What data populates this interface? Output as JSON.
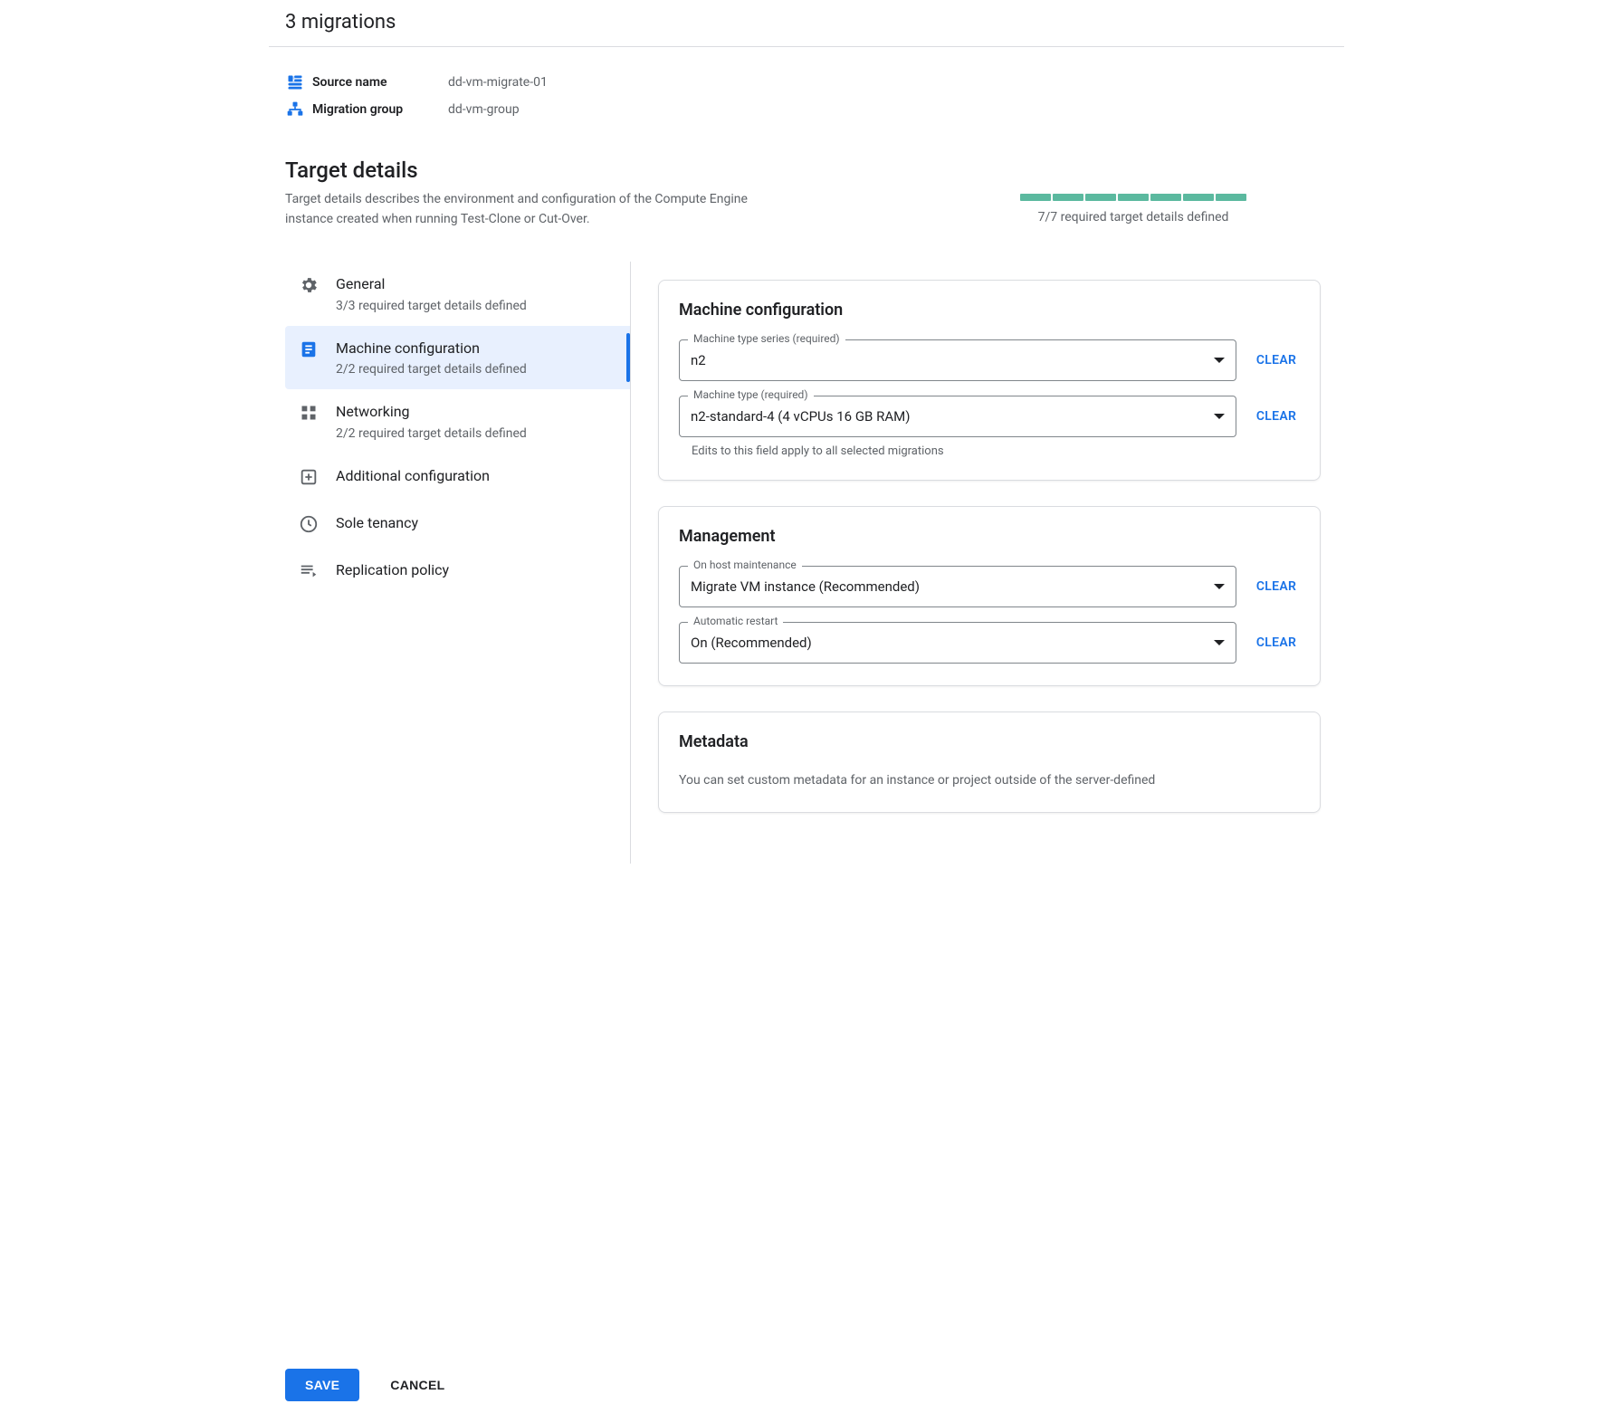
{
  "header": {
    "title": "3 migrations"
  },
  "info": {
    "source_label": "Source name",
    "source_value": "dd-vm-migrate-01",
    "group_label": "Migration group",
    "group_value": "dd-vm-group"
  },
  "section": {
    "title": "Target details",
    "desc": "Target details describes the environment and configuration of the Compute Engine instance created when running Test-Clone or Cut-Over.",
    "progress_text": "7/7 required target details defined",
    "segments": 7
  },
  "nav": [
    {
      "label": "General",
      "sub": "3/3 required target details defined",
      "icon": "gear"
    },
    {
      "label": "Machine configuration",
      "sub": "2/2 required target details defined",
      "icon": "doc",
      "active": true
    },
    {
      "label": "Networking",
      "sub": "2/2 required target details defined",
      "icon": "grid"
    },
    {
      "label": "Additional configuration",
      "sub": "",
      "icon": "add-box"
    },
    {
      "label": "Sole tenancy",
      "sub": "",
      "icon": "clock"
    },
    {
      "label": "Replication policy",
      "sub": "",
      "icon": "policy"
    }
  ],
  "cards": {
    "machine": {
      "title": "Machine configuration",
      "fields": [
        {
          "legend": "Machine type series (required)",
          "value": "n2",
          "clear": "CLEAR"
        },
        {
          "legend": "Machine type (required)",
          "value": "n2-standard-4 (4 vCPUs 16 GB RAM)",
          "clear": "CLEAR",
          "helper": "Edits to this field apply to all selected migrations"
        }
      ]
    },
    "management": {
      "title": "Management",
      "fields": [
        {
          "legend": "On host maintenance",
          "value": "Migrate VM instance (Recommended)",
          "clear": "CLEAR"
        },
        {
          "legend": "Automatic restart",
          "value": "On (Recommended)",
          "clear": "CLEAR"
        }
      ]
    },
    "metadata": {
      "title": "Metadata",
      "desc": "You can set custom metadata for an instance or project outside of the server-defined"
    }
  },
  "footer": {
    "save": "SAVE",
    "cancel": "CANCEL"
  }
}
